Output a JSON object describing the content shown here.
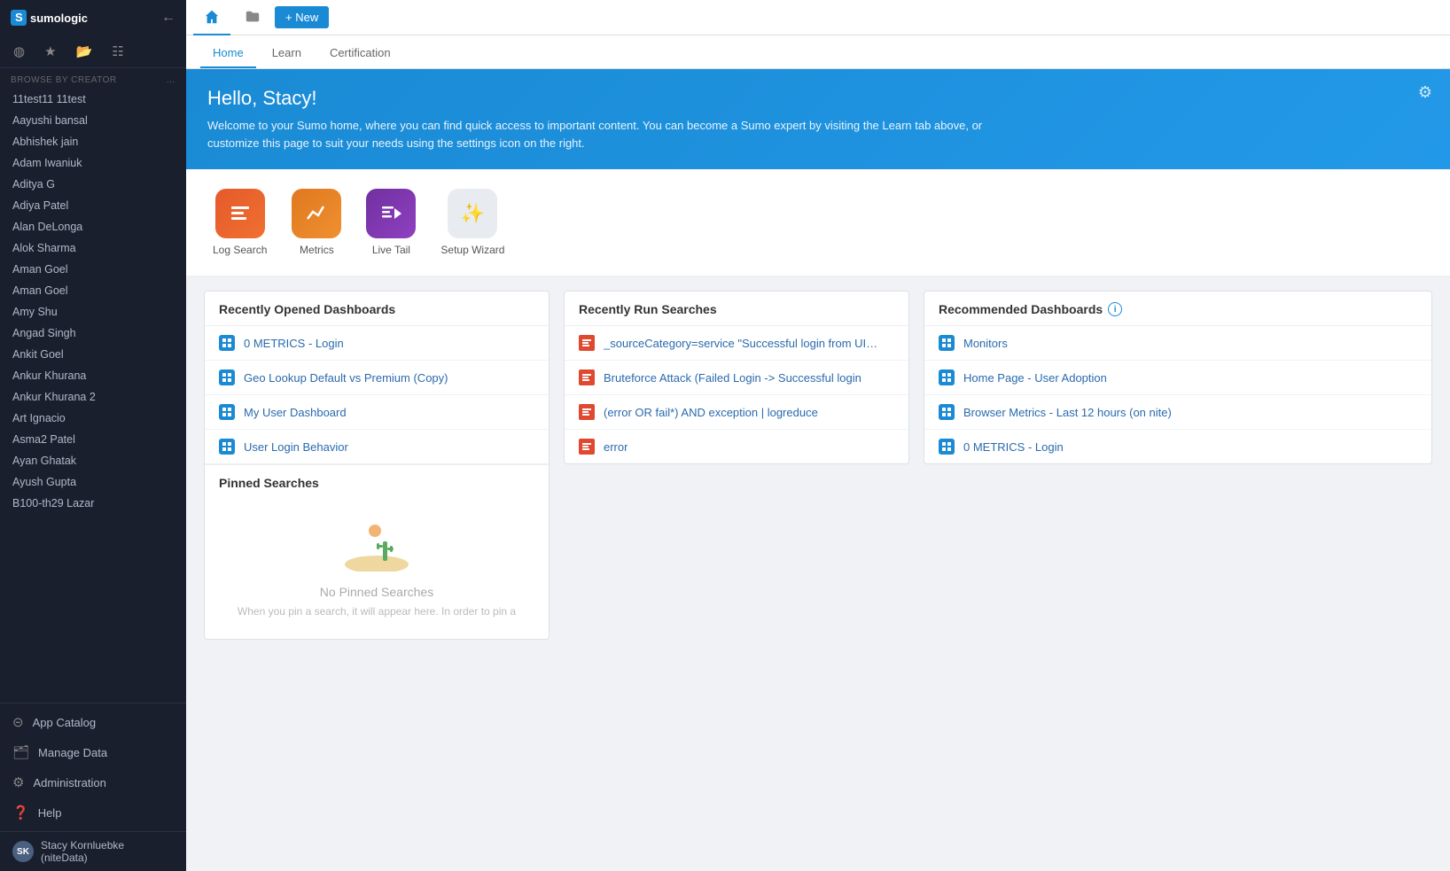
{
  "app": {
    "title": "Sumo Logic"
  },
  "topnav": {
    "new_button_label": "+ New",
    "home_icon": "home",
    "folder_icon": "folder"
  },
  "content_tabs": {
    "tabs": [
      {
        "id": "home",
        "label": "Home",
        "active": true
      },
      {
        "id": "learn",
        "label": "Learn",
        "active": false
      },
      {
        "id": "certification",
        "label": "Certification",
        "active": false
      }
    ]
  },
  "welcome": {
    "greeting": "Hello, Stacy!",
    "description": "Welcome to your Sumo home, where you can find quick access to important content. You can become a Sumo expert by visiting the Learn tab above, or customize this page to suit your needs using the settings icon on the right."
  },
  "quick_access": {
    "items": [
      {
        "id": "log-search",
        "label": "Log Search",
        "icon_type": "log-search"
      },
      {
        "id": "metrics",
        "label": "Metrics",
        "icon_type": "metrics"
      },
      {
        "id": "live-tail",
        "label": "Live Tail",
        "icon_type": "live-tail"
      },
      {
        "id": "setup-wizard",
        "label": "Setup Wizard",
        "icon_type": "setup-wizard"
      }
    ]
  },
  "recently_opened": {
    "title": "Recently Opened Dashboards",
    "items": [
      {
        "label": "0 METRICS - Login",
        "type": "dashboard"
      },
      {
        "label": "Geo Lookup Default vs Premium (Copy)",
        "type": "dashboard"
      },
      {
        "label": "My User Dashboard",
        "type": "dashboard"
      },
      {
        "label": "User Login Behavior",
        "type": "dashboard"
      }
    ]
  },
  "recently_run": {
    "title": "Recently Run Searches",
    "items": [
      {
        "label": "_sourceCategory=service \"Successful login from UI\" | par...",
        "type": "search"
      },
      {
        "label": "Bruteforce Attack (Failed Login -> Successful login",
        "type": "search"
      },
      {
        "label": "(error OR fail*) AND exception | logreduce",
        "type": "search"
      },
      {
        "label": "error",
        "type": "search"
      }
    ]
  },
  "recommended": {
    "title": "Recommended Dashboards",
    "info_tooltip": "Info",
    "items": [
      {
        "label": "Monitors",
        "type": "dashboard"
      },
      {
        "label": "Home Page - User Adoption",
        "type": "dashboard"
      },
      {
        "label": "Browser Metrics - Last 12 hours (on nite)",
        "type": "dashboard"
      },
      {
        "label": "0 METRICS - Login",
        "type": "dashboard"
      }
    ]
  },
  "pinned_searches": {
    "title": "Pinned Searches",
    "empty_title": "No Pinned Searches",
    "empty_description": "When you pin a search, it will appear here. In order to pin a"
  },
  "sidebar": {
    "browse_by_creator_label": "BROWSE BY CREATOR",
    "users": [
      "11test11 11test",
      "Aayushi bansal",
      "Abhishek jain",
      "Adam Iwaniuk",
      "Aditya G",
      "Adiya Patel",
      "Alan DeLonga",
      "Alok Sharma",
      "Aman Goel",
      "Aman Goel",
      "Amy Shu",
      "Angad Singh",
      "Ankit Goel",
      "Ankur Khurana",
      "Ankur Khurana 2",
      "Art Ignacio",
      "Asma2 Patel",
      "Ayan Ghatak",
      "Ayush Gupta",
      "B100-th29 Lazar"
    ],
    "bottom_items": [
      {
        "id": "app-catalog",
        "label": "App Catalog",
        "icon": "grid"
      },
      {
        "id": "manage-data",
        "label": "Manage Data",
        "icon": "database"
      },
      {
        "id": "administration",
        "label": "Administration",
        "icon": "settings"
      },
      {
        "id": "help",
        "label": "Help",
        "icon": "help"
      }
    ],
    "user_profile": {
      "name": "Stacy Kornluebke (niteData)",
      "initials": "SK"
    }
  }
}
